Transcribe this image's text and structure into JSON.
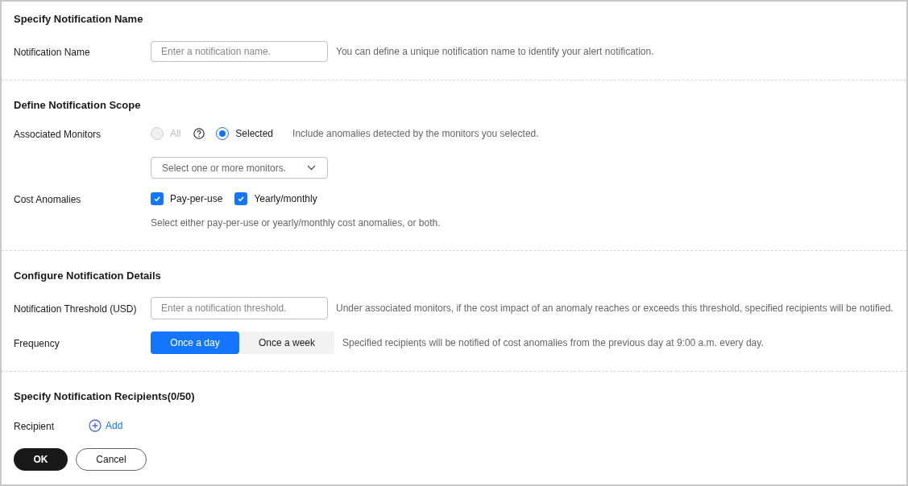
{
  "name_section": {
    "title": "Specify Notification Name",
    "name_field": {
      "label": "Notification Name",
      "placeholder": "Enter a notification name.",
      "hint": "You can define a unique notification name to identify your alert notification."
    }
  },
  "scope_section": {
    "title": "Define Notification Scope",
    "monitors": {
      "label": "Associated Monitors",
      "options": [
        {
          "label": "All",
          "selected": false,
          "disabled": true,
          "help": true
        },
        {
          "label": "Selected",
          "selected": true,
          "disabled": false,
          "help": false
        }
      ],
      "hint": "Include anomalies detected by the monitors you selected.",
      "select_placeholder": "Select one or more monitors."
    },
    "anomalies": {
      "label": "Cost Anomalies",
      "options": [
        {
          "label": "Pay-per-use",
          "checked": true
        },
        {
          "label": "Yearly/monthly",
          "checked": true
        }
      ],
      "hint": "Select either pay-per-use or yearly/monthly cost anomalies, or both."
    }
  },
  "details_section": {
    "title": "Configure Notification Details",
    "threshold": {
      "label": "Notification Threshold (USD)",
      "placeholder": "Enter a notification threshold.",
      "hint": "Under associated monitors, if the cost impact of an anomaly reaches or exceeds this threshold, specified recipients will be notified."
    },
    "frequency": {
      "label": "Frequency",
      "options": [
        {
          "label": "Once a day",
          "selected": true
        },
        {
          "label": "Once a week",
          "selected": false
        }
      ],
      "hint": "Specified recipients will be notified of cost anomalies from the previous day at 9:00 a.m. every day."
    }
  },
  "recipients_section": {
    "title": "Specify Notification Recipients(0/50)",
    "recipient": {
      "label": "Recipient",
      "add": "Add"
    }
  },
  "buttons": [
    {
      "label": "OK",
      "kind": "primary"
    },
    {
      "label": "Cancel",
      "kind": "secondary"
    }
  ]
}
